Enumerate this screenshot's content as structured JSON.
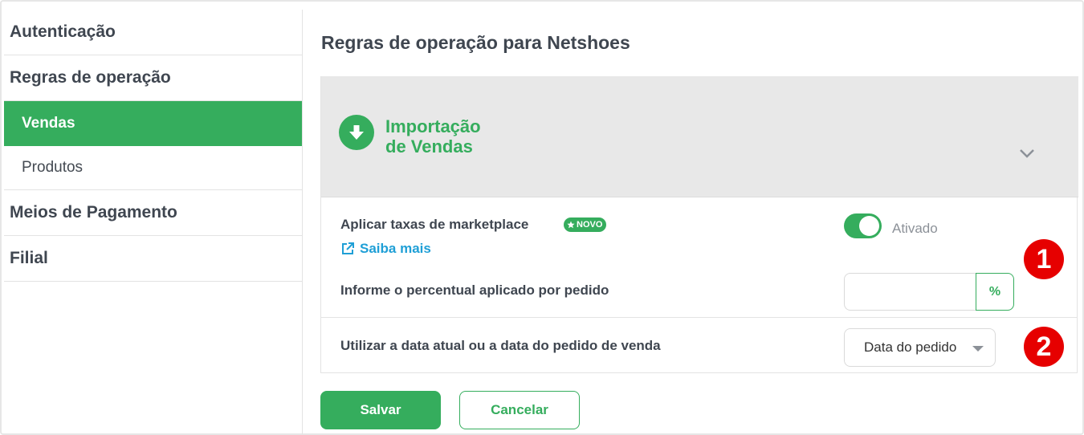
{
  "sidebar": {
    "items": [
      {
        "label": "Autenticação"
      },
      {
        "label": "Regras de operação"
      },
      {
        "label": "Vendas"
      },
      {
        "label": "Produtos"
      },
      {
        "label": "Meios de Pagamento"
      },
      {
        "label": "Filial"
      }
    ],
    "active_item": "Vendas"
  },
  "main": {
    "title": "Regras de operação para Netshoes",
    "section": {
      "title_line1": "Importação",
      "title_line2": "de Vendas",
      "icon": "download-arrow-icon",
      "expand_icon": "chevron-down-icon"
    },
    "marketplace_fee": {
      "label": "Aplicar taxas de marketplace",
      "badge": "NOVO",
      "badge_icon": "star-icon",
      "learn_more": "Saiba mais",
      "learn_more_icon": "external-link-icon",
      "toggle_state": "Ativado",
      "toggle_on": true
    },
    "percent": {
      "label": "Informe o percentual aplicado por pedido",
      "value": "",
      "unit_symbol": "%"
    },
    "date_option": {
      "label": "Utilizar a data atual ou a data do pedido de venda",
      "selected": "Data do pedido"
    },
    "markers": [
      "1",
      "2"
    ]
  },
  "actions": {
    "save": "Salvar",
    "cancel": "Cancelar"
  },
  "colors": {
    "accent": "#35ad5d",
    "link": "#1f9fd6",
    "marker": "#e60000",
    "header_bg": "#e8e8e8"
  }
}
